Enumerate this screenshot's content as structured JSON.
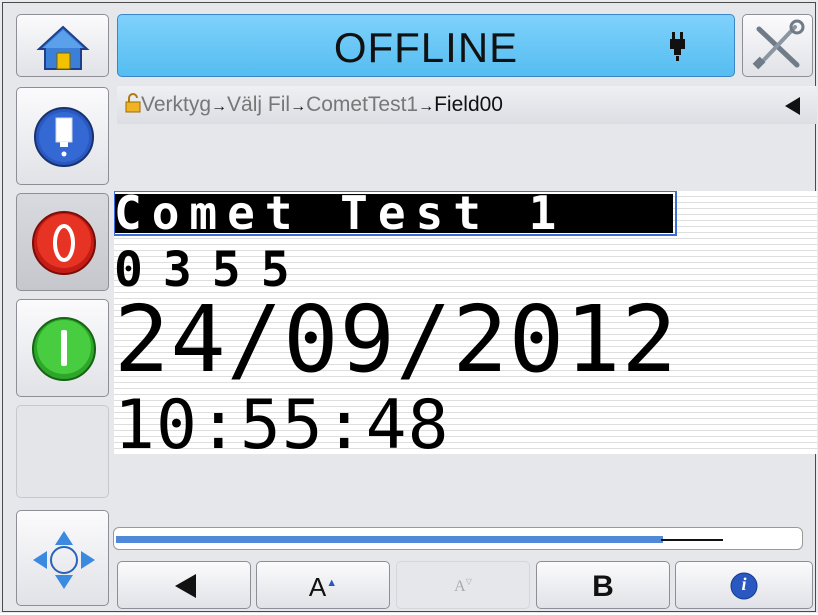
{
  "status": {
    "text": "OFFLINE"
  },
  "breadcrumb": {
    "items": [
      "Verktyg",
      "Välj Fil",
      "CometTest1",
      "Field00"
    ],
    "separator": "→"
  },
  "message": {
    "fields": [
      "Comet Test 1",
      "0355",
      "24/09/2012",
      "10:55:48"
    ]
  },
  "progress": {
    "fraction": 0.8
  },
  "toolbar": {
    "font_up_label": "A",
    "font_down_label": "A",
    "bold_label": "B",
    "info_label": "i"
  },
  "colors": {
    "status_bg": "#55bdf1",
    "stop_red": "#e02b1f",
    "start_green": "#3fc43a",
    "ink_blue": "#2a58c0",
    "progress_blue": "#4f89d8",
    "selection": "#3a6fd8"
  },
  "icons": {
    "home": "home-icon",
    "tools": "tools-icon",
    "nozzle": "nozzle-icon",
    "ink": "ink-cartridge-icon",
    "stop": "stop-icon",
    "start": "start-icon",
    "navigate": "navigate-arrows-icon",
    "lock": "lock-icon",
    "back": "back-arrow-icon",
    "info": "info-icon"
  }
}
